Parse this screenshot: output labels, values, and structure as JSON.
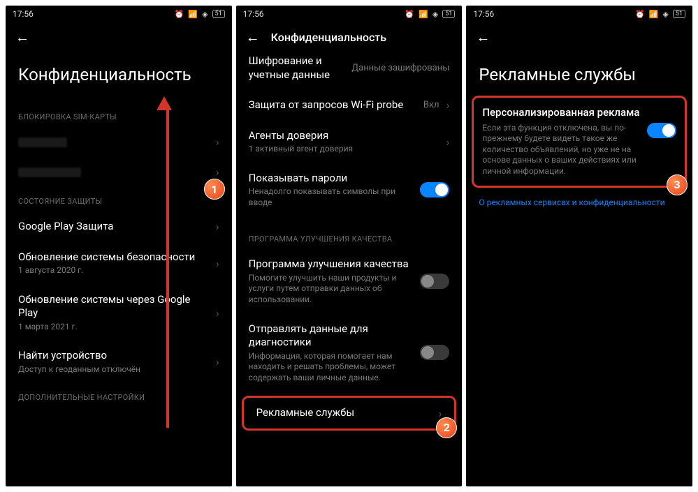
{
  "status": {
    "time": "17:56",
    "battery": "51"
  },
  "screen1": {
    "title": "Конфиденциальность",
    "sec_sim": "БЛОКИРОВКА SIM-КАРТЫ",
    "sec_protect": "СОСТОЯНИЕ ЗАЩИТЫ",
    "play_protect": "Google Play Защита",
    "sec_update": "Обновление системы безопасности",
    "sec_update_sub": "1 августа 2020 г.",
    "gplay_update": "Обновление системы через Google Play",
    "gplay_update_sub": "1 марта 2021 г.",
    "find_device": "Найти устройство",
    "find_device_sub": "Доступ к геоданным отключён",
    "sec_additional": "ДОПОЛНИТЕЛЬНЫЕ НАСТРОЙКИ"
  },
  "screen2": {
    "header": "Конфиденциальность",
    "encrypt": "Шифрование и учетные данные",
    "encrypt_val": "Данные зашифрованы",
    "wifi_probe": "Защита от запросов Wi-Fi probe",
    "wifi_probe_val": "Вкл",
    "trust_agents": "Агенты доверия",
    "trust_agents_sub": "1 активный агент доверия",
    "show_pwd": "Показывать пароли",
    "show_pwd_sub": "Ненадолго показывать символы при вводе",
    "sec_improve": "ПРОГРАММА УЛУЧШЕНИЯ КАЧЕСТВА",
    "improve_prog": "Программа улучшения качества",
    "improve_prog_sub": "Помогите улучшить наши продукты и услуги путем отправки данных об использовании.",
    "diag": "Отправлять данные для диагностики",
    "diag_sub": "Информация, которая помогает нам находить и решать проблемы, может содержать ваши личные данные.",
    "ad_services": "Рекламные службы"
  },
  "screen3": {
    "title": "Рекламные службы",
    "pers_ad": "Персонализированная реклама",
    "pers_ad_sub": "Если эта функция отключена, вы по-прежнему будете видеть такое же количество объявлений, но уже не на основе данных о ваших действиях или личной информации.",
    "about_link": "О рекламных сервисах и конфиденциальности"
  },
  "badges": {
    "b1": "1",
    "b2": "2",
    "b3": "3"
  }
}
